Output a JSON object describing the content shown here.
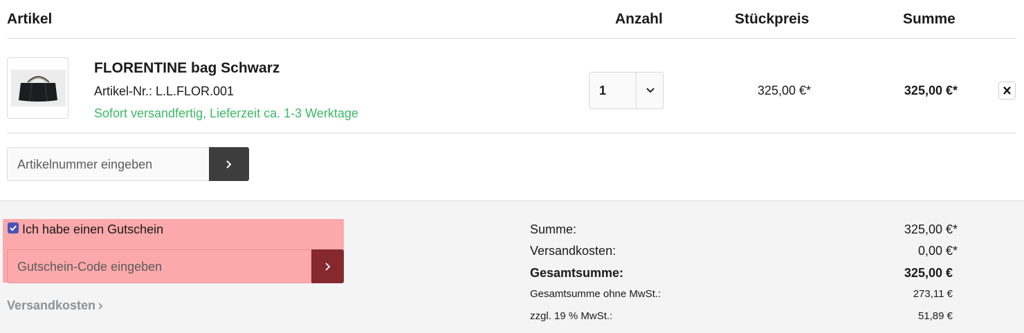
{
  "table_header": {
    "artikel": "Artikel",
    "anzahl": "Anzahl",
    "stueckpreis": "Stückpreis",
    "summe": "Summe"
  },
  "item": {
    "name": "FLORENTINE bag Schwarz",
    "article_number": "Artikel-Nr.: L.L.FLOR.001",
    "delivery": "Sofort versandfertig, Lieferzeit ca. 1-3 Werktage",
    "quantity": "1",
    "unit_price": "325,00 €*",
    "total_price": "325,00 €*"
  },
  "add_product": {
    "placeholder": "Artikelnummer eingeben"
  },
  "coupon": {
    "checkbox_label": "Ich habe einen Gutschein",
    "placeholder": "Gutschein-Code eingeben"
  },
  "shipping_link": "Versandkosten",
  "summary": {
    "rows": [
      {
        "label": "Summe:",
        "value": "325,00 €*"
      },
      {
        "label": "Versandkosten:",
        "value": "0,00 €*"
      },
      {
        "label": "Gesamtsumme:",
        "value": "325,00 €"
      },
      {
        "label": "Gesamtsumme ohne MwSt.:",
        "value": "273,11 €"
      },
      {
        "label": "zzgl. 19 % MwSt.:",
        "value": "51,89 €"
      }
    ]
  },
  "colors": {
    "delivery_green": "#3cb867",
    "coupon_button": "#85292e",
    "coupon_highlight": "#fca9ab",
    "checkbox": "#4a53b8"
  },
  "icons": [
    "chevron-down-icon",
    "close-icon",
    "chevron-right-icon",
    "checkmark-icon"
  ]
}
